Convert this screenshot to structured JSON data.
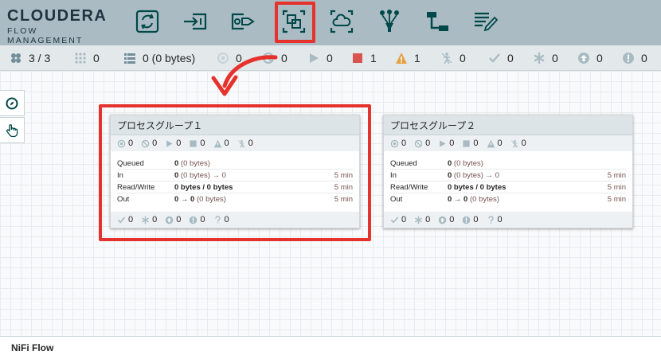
{
  "brand": {
    "name": "CLOUDERA",
    "subtitle": "FLOW MANAGEMENT"
  },
  "toolbar": [
    {
      "name": "processor-tool",
      "icon": "processor-icon"
    },
    {
      "name": "input-port-tool",
      "icon": "input-port-icon"
    },
    {
      "name": "output-port-tool",
      "icon": "output-port-icon"
    },
    {
      "name": "process-group-tool",
      "icon": "process-group-icon",
      "highlighted": true
    },
    {
      "name": "remote-process-group-tool",
      "icon": "remote-process-group-icon"
    },
    {
      "name": "funnel-tool",
      "icon": "funnel-icon"
    },
    {
      "name": "template-tool",
      "icon": "template-icon"
    },
    {
      "name": "label-tool",
      "icon": "label-icon"
    }
  ],
  "status": {
    "cluster": "3 / 3",
    "threads": "0",
    "queued": "0 (0 bytes)",
    "transmitting": "0",
    "not_transmitting": "0",
    "running": "0",
    "stopped": "1",
    "invalid": "1",
    "disabled": "0",
    "up_to_date": "0",
    "locally_modified": "0",
    "stale": "0",
    "sync_failure": "0"
  },
  "groups": [
    {
      "title": "プロセスグループ１",
      "counts": {
        "transmitting": "0",
        "not_transmitting": "0",
        "running": "0",
        "stopped": "0",
        "invalid": "0",
        "disabled": "0"
      },
      "stats": [
        {
          "label": "Queued",
          "bold": "0",
          "rest": " (0 bytes)",
          "time": ""
        },
        {
          "label": "In",
          "bold": "0",
          "rest": " (0 bytes) → 0",
          "time": "5 min"
        },
        {
          "label": "Read/Write",
          "bold": "0 bytes / 0 bytes",
          "rest": "",
          "time": "5 min"
        },
        {
          "label": "Out",
          "bold": "0 → 0",
          "rest": " (0 bytes)",
          "time": "5 min"
        }
      ],
      "versions": {
        "up_to_date": "0",
        "locally_modified": "0",
        "stale": "0",
        "modified_stale": "0",
        "sync_failure": "0"
      }
    },
    {
      "title": "プロセスグループ２",
      "counts": {
        "transmitting": "0",
        "not_transmitting": "0",
        "running": "0",
        "stopped": "0",
        "invalid": "0",
        "disabled": "0"
      },
      "stats": [
        {
          "label": "Queued",
          "bold": "0",
          "rest": " (0 bytes)",
          "time": ""
        },
        {
          "label": "In",
          "bold": "0",
          "rest": " (0 bytes) → 0",
          "time": "5 min"
        },
        {
          "label": "Read/Write",
          "bold": "0 bytes / 0 bytes",
          "rest": "",
          "time": "5 min"
        },
        {
          "label": "Out",
          "bold": "0 → 0",
          "rest": " (0 bytes)",
          "time": "5 min"
        }
      ],
      "versions": {
        "up_to_date": "0",
        "locally_modified": "0",
        "stale": "0",
        "modified_stale": "0",
        "sync_failure": "0"
      }
    }
  ],
  "colors": {
    "header": "#aabbc3",
    "accent": "#004849",
    "annotation": "#e5322d",
    "stopped": "#d9534f",
    "invalid": "#e2a244"
  },
  "breadcrumb": "NiFi Flow"
}
